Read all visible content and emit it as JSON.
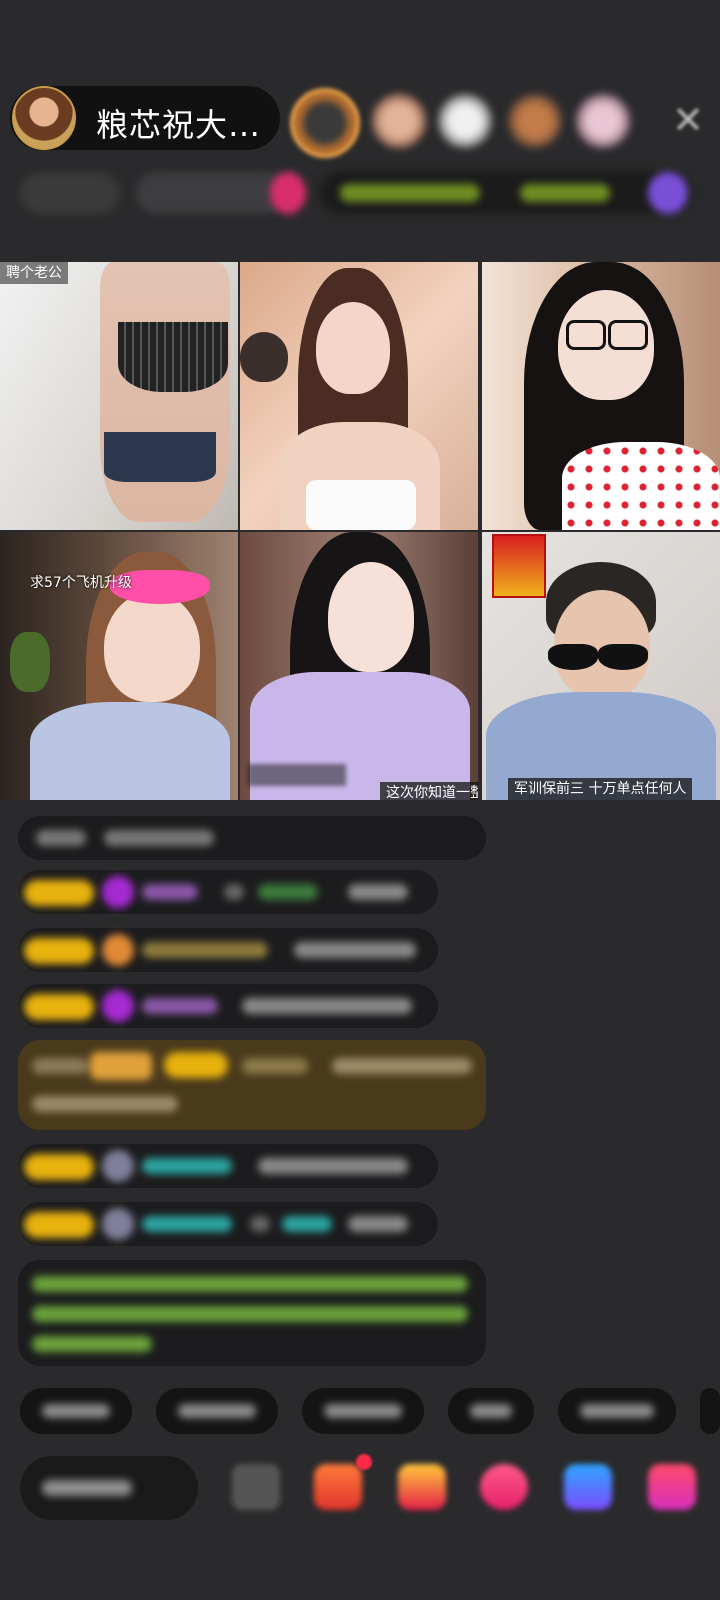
{
  "host": {
    "name": "粮芯祝大…"
  },
  "header": {
    "close_icon": "close-icon"
  },
  "grid": {
    "tiles": [
      {
        "label": "聘个老公"
      },
      {
        "label": ""
      },
      {
        "label": ""
      },
      {
        "label": "求57个飞机升级"
      },
      {
        "label": "这次你知道一整全"
      },
      {
        "label": "军训保前三  十万单点任何人"
      }
    ]
  },
  "colors": {
    "background": "#2a2a2c",
    "badge_gold": "#e7b10e",
    "gem_purple": "#a52ad1",
    "teal_name": "#2aa3a0",
    "green_text": "#6aa13a"
  }
}
